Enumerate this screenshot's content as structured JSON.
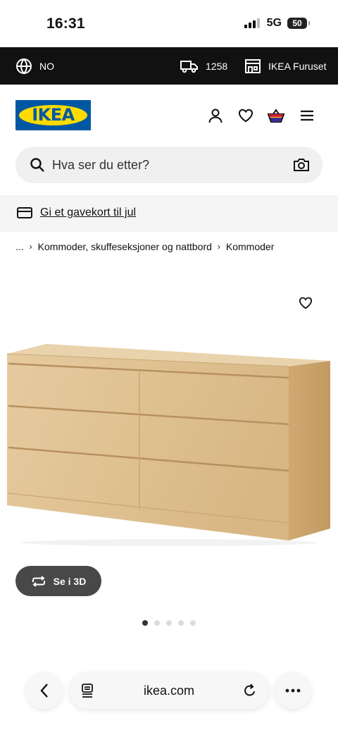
{
  "status_bar": {
    "time": "16:31",
    "network": "5G",
    "battery": "50"
  },
  "top_bar": {
    "language": "NO",
    "postcode": "1258",
    "store": "IKEA Furuset"
  },
  "header": {
    "logo_text": "IKEA"
  },
  "search": {
    "placeholder": "Hva ser du etter?"
  },
  "promo": {
    "link": "Gi et gavekort til jul"
  },
  "breadcrumb": {
    "ellipsis": "...",
    "items": [
      "Kommoder, skuffeseksjoner og nattbord",
      "Kommoder"
    ]
  },
  "product": {
    "view_3d_label": "Se i 3D",
    "image_count": 5,
    "active_image": 0
  },
  "browser": {
    "url": "ikea.com"
  },
  "colors": {
    "brand_blue": "#0058a3",
    "brand_yellow": "#ffdb00",
    "top_bar_bg": "#111111",
    "button_dark": "#484848"
  }
}
